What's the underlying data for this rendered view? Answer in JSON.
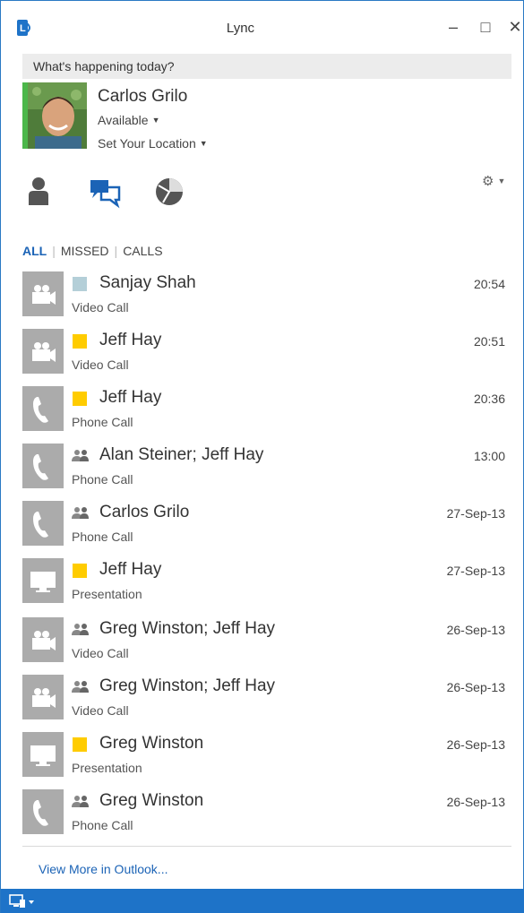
{
  "window": {
    "title": "Lync",
    "minimize": "–",
    "maximize": "□",
    "close": "✕"
  },
  "colors": {
    "accent": "#1b63b6",
    "bottom_bar": "#1e73c8",
    "presence_available": "#4cb74a",
    "presence_away": "#ffcc00",
    "presence_offline": "#b4cfd8",
    "icon_tile": "#ababab"
  },
  "note": {
    "text": "What's happening today?"
  },
  "profile": {
    "name": "Carlos Grilo",
    "status": "Available",
    "location": "Set Your Location"
  },
  "filters": {
    "all": "ALL",
    "missed": "MISSED",
    "calls": "CALLS"
  },
  "conversations": [
    {
      "icon": "video-camera-icon",
      "presence": "offline",
      "name": "Sanjay Shah",
      "type": "Video Call",
      "time": "20:54"
    },
    {
      "icon": "video-camera-icon",
      "presence": "away",
      "name": "Jeff Hay",
      "type": "Video Call",
      "time": "20:51"
    },
    {
      "icon": "phone-icon",
      "presence": "away",
      "name": "Jeff Hay",
      "type": "Phone Call",
      "time": "20:36"
    },
    {
      "icon": "phone-icon",
      "presence": "group",
      "name": "Alan Steiner; Jeff Hay",
      "type": "Phone Call",
      "time": "13:00"
    },
    {
      "icon": "phone-icon",
      "presence": "group",
      "name": "Carlos Grilo",
      "type": "Phone Call",
      "time": "27-Sep-13"
    },
    {
      "icon": "monitor-icon",
      "presence": "away",
      "name": "Jeff Hay",
      "type": "Presentation",
      "time": "27-Sep-13"
    },
    {
      "icon": "video-camera-icon",
      "presence": "group",
      "name": "Greg Winston; Jeff Hay",
      "type": "Video Call",
      "time": "26-Sep-13"
    },
    {
      "icon": "video-camera-icon",
      "presence": "group",
      "name": "Greg Winston; Jeff Hay",
      "type": "Video Call",
      "time": "26-Sep-13"
    },
    {
      "icon": "monitor-icon",
      "presence": "away",
      "name": "Greg Winston",
      "type": "Presentation",
      "time": "26-Sep-13"
    },
    {
      "icon": "phone-icon",
      "presence": "group",
      "name": "Greg Winston",
      "type": "Phone Call",
      "time": "26-Sep-13"
    }
  ],
  "footer": {
    "more_link": "View More in Outlook..."
  }
}
